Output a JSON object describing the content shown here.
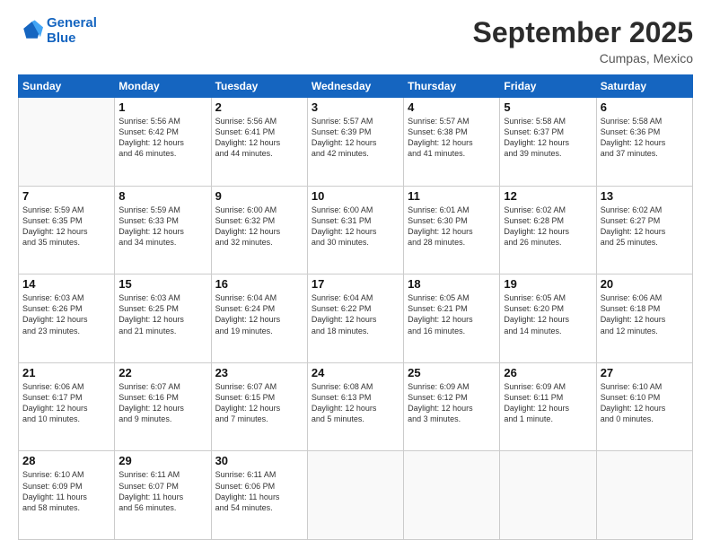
{
  "logo": {
    "line1": "General",
    "line2": "Blue"
  },
  "title": "September 2025",
  "location": "Cumpas, Mexico",
  "days_of_week": [
    "Sunday",
    "Monday",
    "Tuesday",
    "Wednesday",
    "Thursday",
    "Friday",
    "Saturday"
  ],
  "weeks": [
    [
      {
        "day": "",
        "info": ""
      },
      {
        "day": "1",
        "info": "Sunrise: 5:56 AM\nSunset: 6:42 PM\nDaylight: 12 hours\nand 46 minutes."
      },
      {
        "day": "2",
        "info": "Sunrise: 5:56 AM\nSunset: 6:41 PM\nDaylight: 12 hours\nand 44 minutes."
      },
      {
        "day": "3",
        "info": "Sunrise: 5:57 AM\nSunset: 6:39 PM\nDaylight: 12 hours\nand 42 minutes."
      },
      {
        "day": "4",
        "info": "Sunrise: 5:57 AM\nSunset: 6:38 PM\nDaylight: 12 hours\nand 41 minutes."
      },
      {
        "day": "5",
        "info": "Sunrise: 5:58 AM\nSunset: 6:37 PM\nDaylight: 12 hours\nand 39 minutes."
      },
      {
        "day": "6",
        "info": "Sunrise: 5:58 AM\nSunset: 6:36 PM\nDaylight: 12 hours\nand 37 minutes."
      }
    ],
    [
      {
        "day": "7",
        "info": "Sunrise: 5:59 AM\nSunset: 6:35 PM\nDaylight: 12 hours\nand 35 minutes."
      },
      {
        "day": "8",
        "info": "Sunrise: 5:59 AM\nSunset: 6:33 PM\nDaylight: 12 hours\nand 34 minutes."
      },
      {
        "day": "9",
        "info": "Sunrise: 6:00 AM\nSunset: 6:32 PM\nDaylight: 12 hours\nand 32 minutes."
      },
      {
        "day": "10",
        "info": "Sunrise: 6:00 AM\nSunset: 6:31 PM\nDaylight: 12 hours\nand 30 minutes."
      },
      {
        "day": "11",
        "info": "Sunrise: 6:01 AM\nSunset: 6:30 PM\nDaylight: 12 hours\nand 28 minutes."
      },
      {
        "day": "12",
        "info": "Sunrise: 6:02 AM\nSunset: 6:28 PM\nDaylight: 12 hours\nand 26 minutes."
      },
      {
        "day": "13",
        "info": "Sunrise: 6:02 AM\nSunset: 6:27 PM\nDaylight: 12 hours\nand 25 minutes."
      }
    ],
    [
      {
        "day": "14",
        "info": "Sunrise: 6:03 AM\nSunset: 6:26 PM\nDaylight: 12 hours\nand 23 minutes."
      },
      {
        "day": "15",
        "info": "Sunrise: 6:03 AM\nSunset: 6:25 PM\nDaylight: 12 hours\nand 21 minutes."
      },
      {
        "day": "16",
        "info": "Sunrise: 6:04 AM\nSunset: 6:24 PM\nDaylight: 12 hours\nand 19 minutes."
      },
      {
        "day": "17",
        "info": "Sunrise: 6:04 AM\nSunset: 6:22 PM\nDaylight: 12 hours\nand 18 minutes."
      },
      {
        "day": "18",
        "info": "Sunrise: 6:05 AM\nSunset: 6:21 PM\nDaylight: 12 hours\nand 16 minutes."
      },
      {
        "day": "19",
        "info": "Sunrise: 6:05 AM\nSunset: 6:20 PM\nDaylight: 12 hours\nand 14 minutes."
      },
      {
        "day": "20",
        "info": "Sunrise: 6:06 AM\nSunset: 6:18 PM\nDaylight: 12 hours\nand 12 minutes."
      }
    ],
    [
      {
        "day": "21",
        "info": "Sunrise: 6:06 AM\nSunset: 6:17 PM\nDaylight: 12 hours\nand 10 minutes."
      },
      {
        "day": "22",
        "info": "Sunrise: 6:07 AM\nSunset: 6:16 PM\nDaylight: 12 hours\nand 9 minutes."
      },
      {
        "day": "23",
        "info": "Sunrise: 6:07 AM\nSunset: 6:15 PM\nDaylight: 12 hours\nand 7 minutes."
      },
      {
        "day": "24",
        "info": "Sunrise: 6:08 AM\nSunset: 6:13 PM\nDaylight: 12 hours\nand 5 minutes."
      },
      {
        "day": "25",
        "info": "Sunrise: 6:09 AM\nSunset: 6:12 PM\nDaylight: 12 hours\nand 3 minutes."
      },
      {
        "day": "26",
        "info": "Sunrise: 6:09 AM\nSunset: 6:11 PM\nDaylight: 12 hours\nand 1 minute."
      },
      {
        "day": "27",
        "info": "Sunrise: 6:10 AM\nSunset: 6:10 PM\nDaylight: 12 hours\nand 0 minutes."
      }
    ],
    [
      {
        "day": "28",
        "info": "Sunrise: 6:10 AM\nSunset: 6:09 PM\nDaylight: 11 hours\nand 58 minutes."
      },
      {
        "day": "29",
        "info": "Sunrise: 6:11 AM\nSunset: 6:07 PM\nDaylight: 11 hours\nand 56 minutes."
      },
      {
        "day": "30",
        "info": "Sunrise: 6:11 AM\nSunset: 6:06 PM\nDaylight: 11 hours\nand 54 minutes."
      },
      {
        "day": "",
        "info": ""
      },
      {
        "day": "",
        "info": ""
      },
      {
        "day": "",
        "info": ""
      },
      {
        "day": "",
        "info": ""
      }
    ]
  ]
}
